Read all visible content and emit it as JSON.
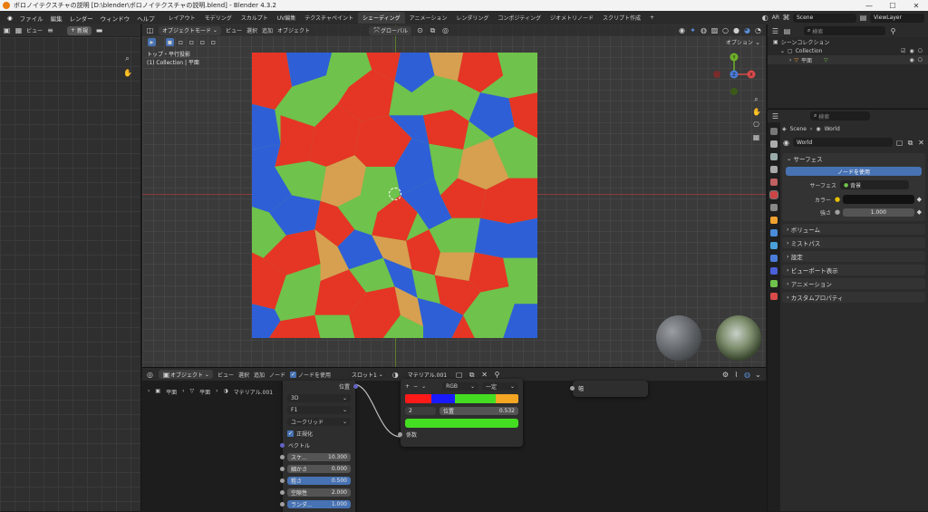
{
  "window": {
    "title": "ボロノイテクスチャの説明 [D:\\blender\\ボロノイテクスチャの説明.blend] - Blender 4.3.2"
  },
  "menu": [
    "ファイル",
    "編集",
    "レンダー",
    "ウィンドウ",
    "ヘルプ"
  ],
  "workspace_tabs": [
    "レイアウト",
    "モデリング",
    "スカルプト",
    "UV編集",
    "テクスチャペイント",
    "シェーディング",
    "アニメーション",
    "レンダリング",
    "コンポジティング",
    "ジオメトリノード",
    "スクリプト作成"
  ],
  "active_tab": "シェーディング",
  "topbar_right": {
    "ar": "AR",
    "scene": "Scene",
    "view_layer": "ViewLayer"
  },
  "left_header": {
    "view": "ビュー",
    "new": "新規"
  },
  "viewport": {
    "mode": "オブジェクトモード",
    "menus": [
      "ビュー",
      "選択",
      "追加",
      "オブジェクト"
    ],
    "transform": "グローバル",
    "options": "オプション",
    "info_line1": "トップ・平行投影",
    "info_line2": "(1) Collection | 平面",
    "gizmo": {
      "x": "X",
      "y": "Y",
      "z": "Z"
    }
  },
  "node_editor": {
    "mode": "オブジェクト",
    "menus": [
      "ビュー",
      "選択",
      "追加",
      "ノード"
    ],
    "use_nodes": "ノードを使用",
    "slot": "スロット1",
    "material": "マテリアル.001",
    "breadcrumb": [
      "平面",
      "平面",
      "マテリアル.001"
    ],
    "voronoi": {
      "position_label": "位置",
      "dimension": "3D",
      "feature": "F1",
      "distance": "ユークリッド",
      "normalize": "正規化",
      "vector": "ベクトル",
      "params": [
        {
          "label": "スケ...",
          "value": "10.300"
        },
        {
          "label": "細かさ",
          "value": "0.000"
        },
        {
          "label": "粗さ",
          "value": "0.500"
        },
        {
          "label": "空隙性",
          "value": "2.000"
        },
        {
          "label": "ランダ...",
          "value": "1.000"
        }
      ]
    },
    "colorramp": {
      "mode": "RGB",
      "interp": "一定",
      "index": "2",
      "pos_label": "位置",
      "pos_value": "0.532",
      "factor": "係数",
      "stops": [
        "#ff1a1a",
        "#1a1aff",
        "#44dd22",
        "#f5a623"
      ]
    },
    "output_node": {
      "label": "幅"
    }
  },
  "outliner": {
    "search_placeholder": "検索",
    "scene_collection": "シーンコレクション",
    "collection": "Collection",
    "object": "平面"
  },
  "properties": {
    "search_placeholder": "検索",
    "breadcrumb": [
      "Scene",
      "World"
    ],
    "world_name": "World",
    "surface_panel": "サーフェス",
    "use_nodes_btn": "ノードを使用",
    "surface_label": "サーフェス",
    "surface_value": "背景",
    "color_label": "カラー",
    "strength_label": "強さ",
    "strength_value": "1.000",
    "panels": [
      "ボリューム",
      "ミストパス",
      "設定",
      "ビューポート表示",
      "アニメーション",
      "カスタムプロパティ"
    ]
  }
}
